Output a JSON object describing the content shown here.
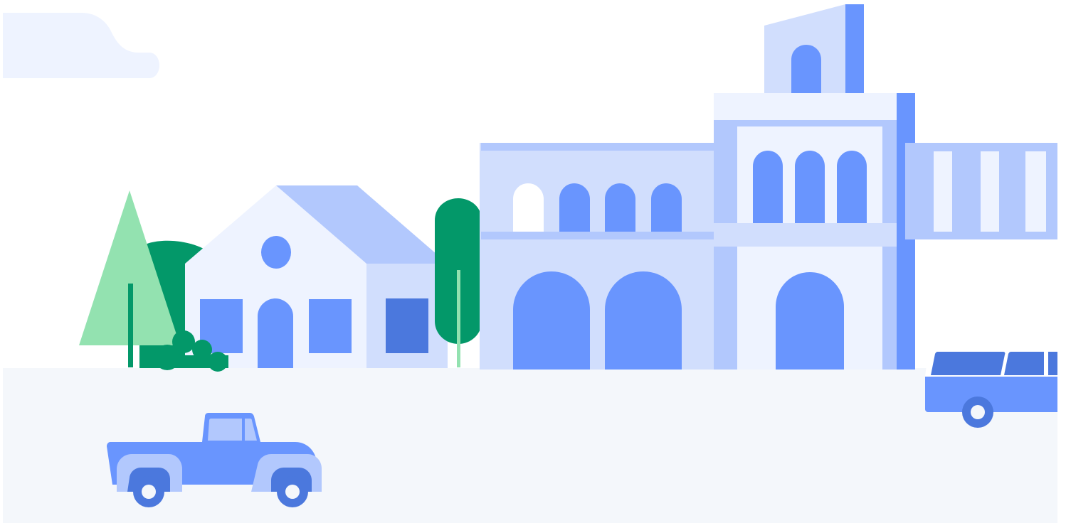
{
  "scene": {
    "kind": "illustration",
    "elements": [
      "cloud",
      "pine-tree",
      "round-tree",
      "bush",
      "house",
      "tall-tree",
      "arched-building",
      "tower-building",
      "side-building",
      "pickup-truck",
      "van",
      "ground"
    ]
  },
  "colors": {
    "background": "#ffffff",
    "ground": "#f4f7fb",
    "cloud": "#eef3ff",
    "light_wall": "#eef3ff",
    "pale_blue": "#d1defd",
    "mid_blue": "#b2c8fd",
    "blue": "#6995fe",
    "dark_blue": "#4b78dd",
    "tree_dark": "#039869",
    "tree_light": "#93e2b0"
  }
}
